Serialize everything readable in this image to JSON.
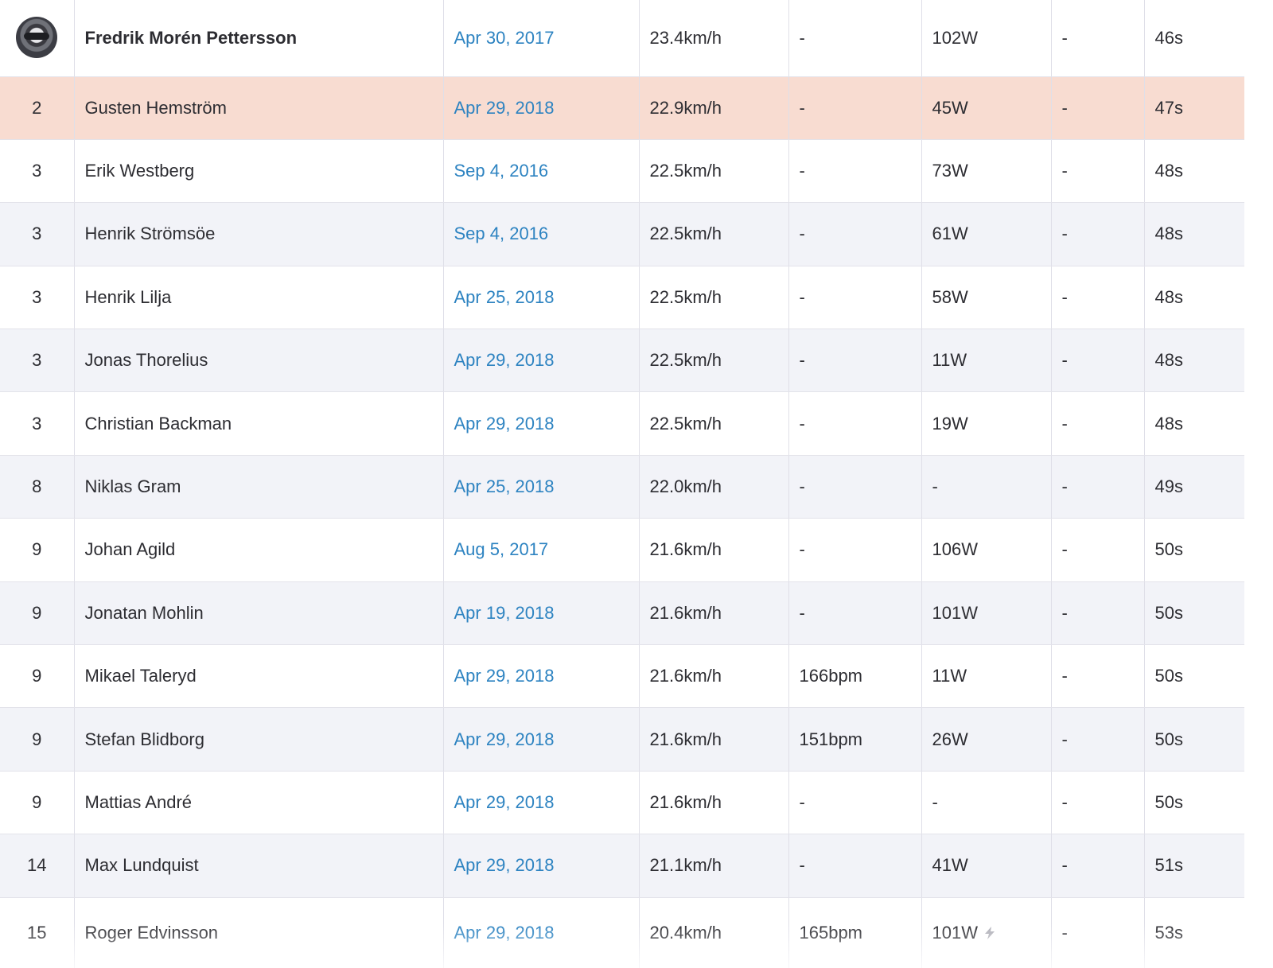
{
  "rows": [
    {
      "rank": "",
      "name": "Fredrik Morén Pettersson",
      "date": "Apr 30, 2017",
      "speed": "23.4km/h",
      "hr": "-",
      "power": "102W",
      "vam": "-",
      "time": "46s"
    },
    {
      "rank": "2",
      "name": "Gusten Hemström",
      "date": "Apr 29, 2018",
      "speed": "22.9km/h",
      "hr": "-",
      "power": "45W",
      "vam": "-",
      "time": "47s"
    },
    {
      "rank": "3",
      "name": "Erik Westberg",
      "date": "Sep 4, 2016",
      "speed": "22.5km/h",
      "hr": "-",
      "power": "73W",
      "vam": "-",
      "time": "48s"
    },
    {
      "rank": "3",
      "name": "Henrik Strömsöe",
      "date": "Sep 4, 2016",
      "speed": "22.5km/h",
      "hr": "-",
      "power": "61W",
      "vam": "-",
      "time": "48s"
    },
    {
      "rank": "3",
      "name": "Henrik Lilja",
      "date": "Apr 25, 2018",
      "speed": "22.5km/h",
      "hr": "-",
      "power": "58W",
      "vam": "-",
      "time": "48s"
    },
    {
      "rank": "3",
      "name": "Jonas Thorelius",
      "date": "Apr 29, 2018",
      "speed": "22.5km/h",
      "hr": "-",
      "power": "11W",
      "vam": "-",
      "time": "48s"
    },
    {
      "rank": "3",
      "name": "Christian Backman",
      "date": "Apr 29, 2018",
      "speed": "22.5km/h",
      "hr": "-",
      "power": "19W",
      "vam": "-",
      "time": "48s"
    },
    {
      "rank": "8",
      "name": "Niklas Gram",
      "date": "Apr 25, 2018",
      "speed": "22.0km/h",
      "hr": "-",
      "power": "-",
      "vam": "-",
      "time": "49s"
    },
    {
      "rank": "9",
      "name": "Johan Agild",
      "date": "Aug 5, 2017",
      "speed": "21.6km/h",
      "hr": "-",
      "power": "106W",
      "vam": "-",
      "time": "50s"
    },
    {
      "rank": "9",
      "name": "Jonatan Mohlin",
      "date": "Apr 19, 2018",
      "speed": "21.6km/h",
      "hr": "-",
      "power": "101W",
      "vam": "-",
      "time": "50s"
    },
    {
      "rank": "9",
      "name": "Mikael Taleryd",
      "date": "Apr 29, 2018",
      "speed": "21.6km/h",
      "hr": "166bpm",
      "power": "11W",
      "vam": "-",
      "time": "50s"
    },
    {
      "rank": "9",
      "name": "Stefan Blidborg",
      "date": "Apr 29, 2018",
      "speed": "21.6km/h",
      "hr": "151bpm",
      "power": "26W",
      "vam": "-",
      "time": "50s"
    },
    {
      "rank": "9",
      "name": "Mattias André",
      "date": "Apr 29, 2018",
      "speed": "21.6km/h",
      "hr": "-",
      "power": "-",
      "vam": "-",
      "time": "50s"
    },
    {
      "rank": "14",
      "name": "Max Lundquist",
      "date": "Apr 29, 2018",
      "speed": "21.1km/h",
      "hr": "-",
      "power": "41W",
      "vam": "-",
      "time": "51s"
    },
    {
      "rank": "15",
      "name": "Roger Edvinsson",
      "date": "Apr 29, 2018",
      "speed": "20.4km/h",
      "hr": "165bpm",
      "power": "101W",
      "vam": "-",
      "time": "53s"
    }
  ],
  "first_row": {
    "avatar_icon": "avatar"
  },
  "highlight_color": "#f8dcd1",
  "link_color": "#2d83c1",
  "last_row_power_icon": "lightning-bolt-icon"
}
